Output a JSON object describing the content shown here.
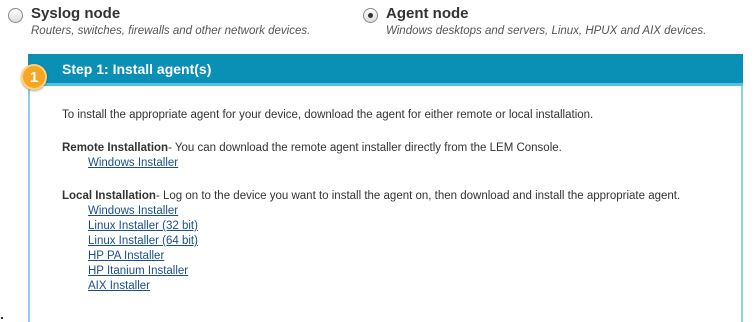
{
  "node_types": {
    "syslog": {
      "title": "Syslog node",
      "description": "Routers, switches, firewalls and other network devices.",
      "selected": false
    },
    "agent": {
      "title": "Agent node",
      "description": "Windows desktops and servers, Linux, HPUX and AIX devices.",
      "selected": true
    }
  },
  "step": {
    "number": "1",
    "title": "Step 1: Install agent(s)",
    "intro": "To install the appropriate agent for your device, download the agent for either remote or local installation.",
    "remote": {
      "heading": "Remote Installation",
      "text": "- You can download the remote agent installer directly from the LEM Console.",
      "links": [
        "Windows Installer"
      ]
    },
    "local": {
      "heading": "Local Installation",
      "text": "- Log on to the device you want to install the agent on, then download and install the appropriate agent.",
      "links": [
        "Windows Installer",
        "Linux Installer (32 bit)",
        "Linux Installer (64 bit)",
        "HP PA Installer",
        "HP Itanium Installer",
        "AIX Installer"
      ]
    }
  },
  "colors": {
    "header_bg": "#0a8fb5",
    "panel_border": "#8fd0e8",
    "badge": "#f6a623",
    "link": "#1a4f8a"
  }
}
